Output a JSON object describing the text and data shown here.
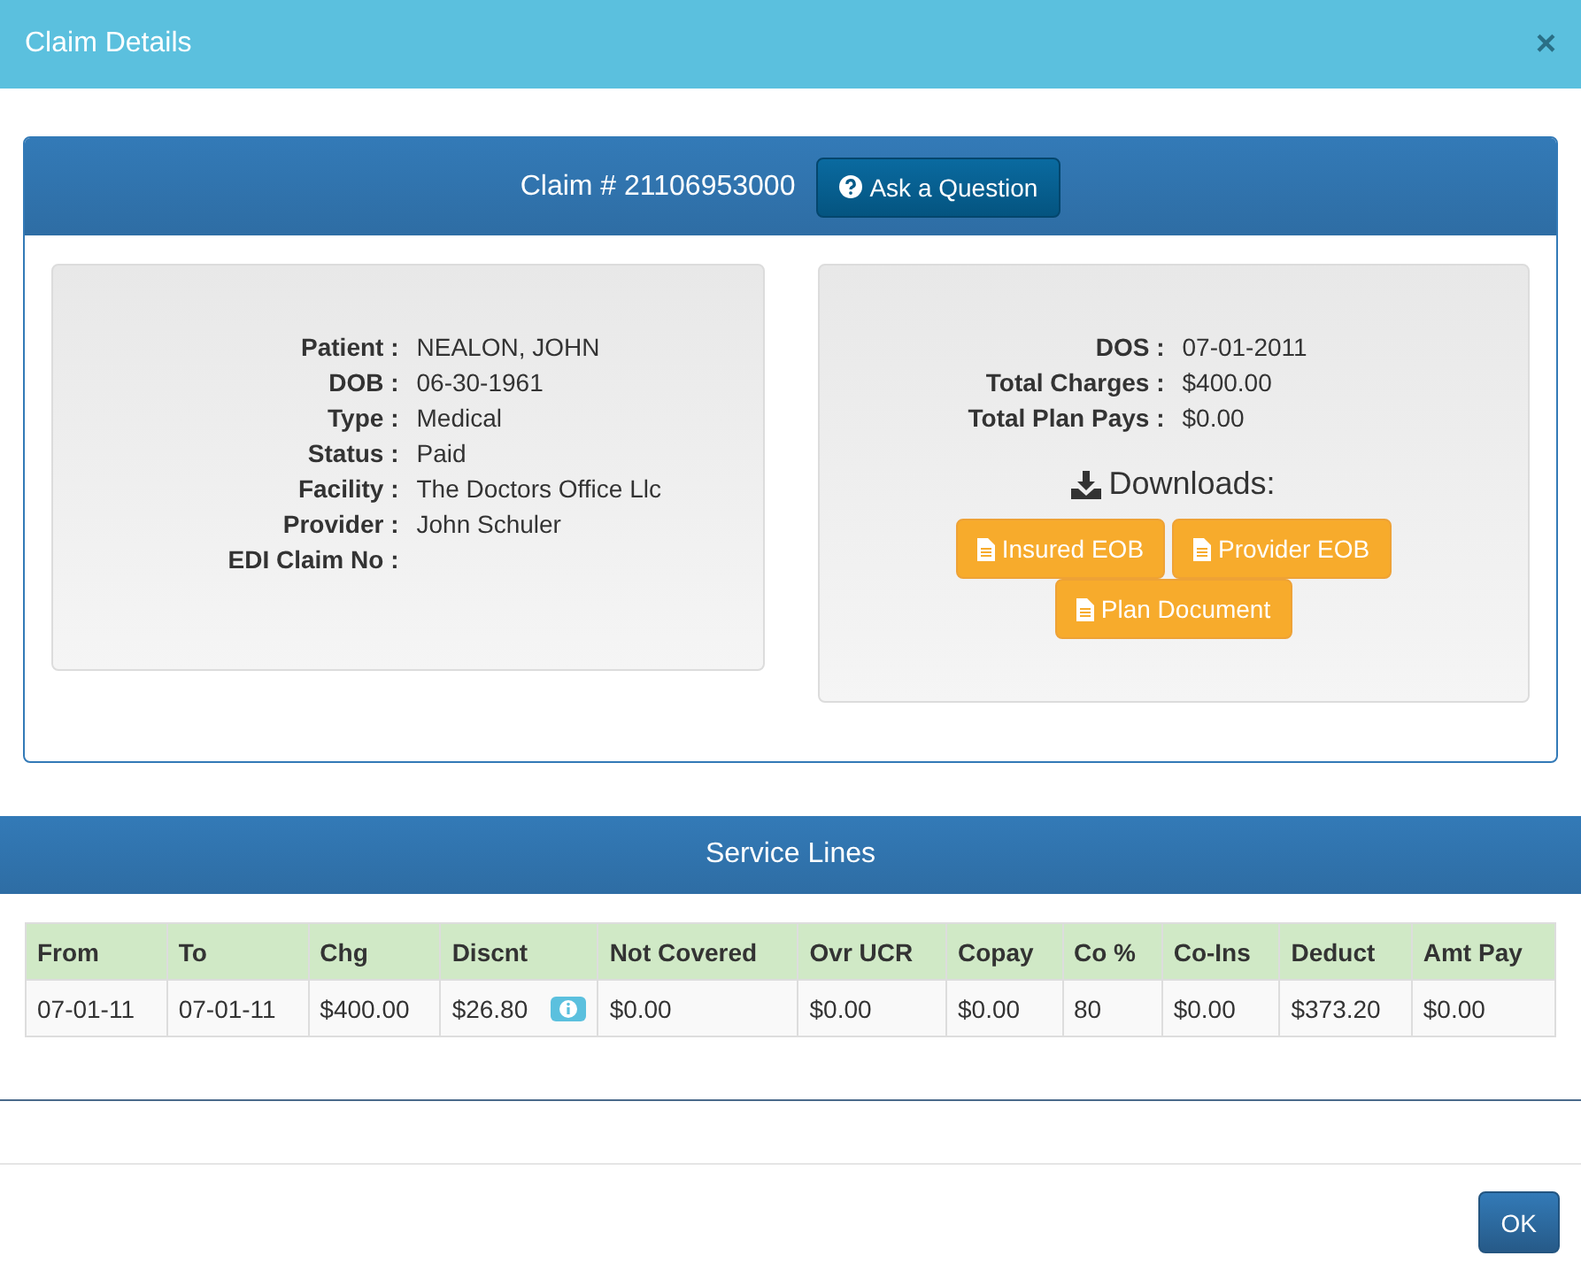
{
  "window": {
    "title": "Claim Details",
    "close": "×"
  },
  "claim": {
    "heading": "Claim # 21106953000",
    "ask_button": "Ask a Question",
    "details": [
      {
        "label": "Patient :",
        "value": "NEALON, JOHN"
      },
      {
        "label": "DOB :",
        "value": "06-30-1961"
      },
      {
        "label": "Type :",
        "value": "Medical"
      },
      {
        "label": "Status :",
        "value": "Paid"
      },
      {
        "label": "Facility :",
        "value": "The Doctors Office Llc"
      },
      {
        "label": "Provider :",
        "value": "John Schuler"
      },
      {
        "label": "EDI Claim No :"
      }
    ],
    "totals": [
      {
        "label": "DOS :",
        "value": "07-01-2011"
      },
      {
        "label": "Total Charges :",
        "value": "$400.00"
      },
      {
        "label": "Total Plan Pays :",
        "value": "$0.00"
      }
    ],
    "downloads": {
      "title": "Downloads:",
      "buttons": [
        "Insured EOB",
        "Provider EOB",
        "Plan Document"
      ]
    }
  },
  "service_lines": {
    "title": "Service Lines",
    "columns": [
      "From",
      "To",
      "Chg",
      "Discnt",
      "Not Covered",
      "Ovr UCR",
      "Copay",
      "Co %",
      "Co-Ins",
      "Deduct",
      "Amt Pay"
    ],
    "rows": [
      {
        "cells": [
          {
            "text": "07-01-11",
            "info": false
          },
          {
            "text": "07-01-11",
            "info": false
          },
          {
            "text": "$400.00",
            "info": false
          },
          {
            "text": "$26.80",
            "info": true
          },
          {
            "text": "$0.00",
            "info": false
          },
          {
            "text": "$0.00",
            "info": false
          },
          {
            "text": "$0.00",
            "info": false
          },
          {
            "text": "80",
            "info": false
          },
          {
            "text": "$0.00",
            "info": false
          },
          {
            "text": "$373.20",
            "info": false
          },
          {
            "text": "$0.00",
            "info": false
          }
        ]
      }
    ]
  },
  "buttons": [
    "OK"
  ]
}
